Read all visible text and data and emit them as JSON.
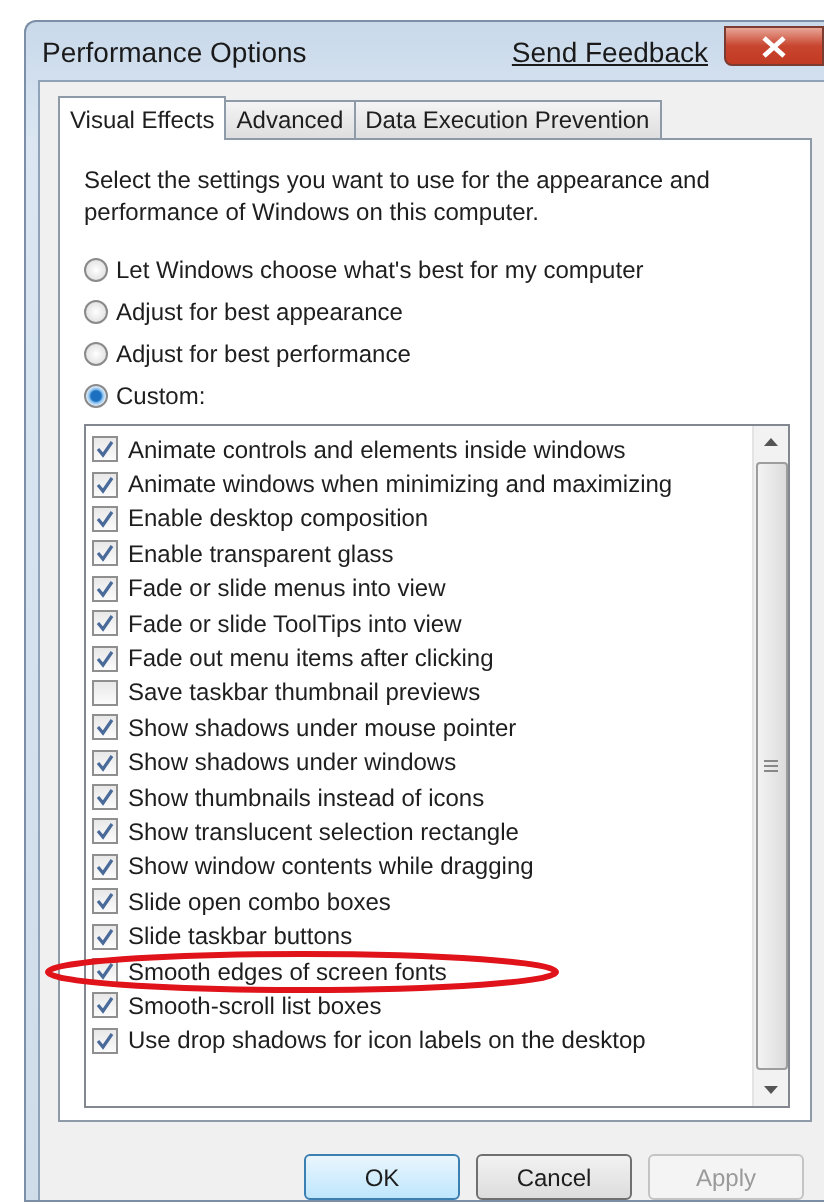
{
  "window": {
    "title": "Performance Options",
    "feedback_link": "Send Feedback"
  },
  "tabs": [
    {
      "label": "Visual Effects",
      "selected": true
    },
    {
      "label": "Advanced",
      "selected": false
    },
    {
      "label": "Data Execution Prevention",
      "selected": false
    }
  ],
  "description": "Select the settings you want to use for the appearance and performance of Windows on this computer.",
  "options": [
    {
      "label": "Let Windows choose what's best for my computer",
      "selected": false
    },
    {
      "label": "Adjust for best appearance",
      "selected": false
    },
    {
      "label": "Adjust for best performance",
      "selected": false
    },
    {
      "label": "Custom:",
      "selected": true
    }
  ],
  "effects": [
    {
      "label": "Animate controls and elements inside windows",
      "checked": true
    },
    {
      "label": "Animate windows when minimizing and maximizing",
      "checked": true
    },
    {
      "label": "Enable desktop composition",
      "checked": true
    },
    {
      "label": "Enable transparent glass",
      "checked": true
    },
    {
      "label": "Fade or slide menus into view",
      "checked": true
    },
    {
      "label": "Fade or slide ToolTips into view",
      "checked": true
    },
    {
      "label": "Fade out menu items after clicking",
      "checked": true
    },
    {
      "label": "Save taskbar thumbnail previews",
      "checked": false
    },
    {
      "label": "Show shadows under mouse pointer",
      "checked": true
    },
    {
      "label": "Show shadows under windows",
      "checked": true
    },
    {
      "label": "Show thumbnails instead of icons",
      "checked": true
    },
    {
      "label": "Show translucent selection rectangle",
      "checked": true
    },
    {
      "label": "Show window contents while dragging",
      "checked": true
    },
    {
      "label": "Slide open combo boxes",
      "checked": true
    },
    {
      "label": "Slide taskbar buttons",
      "checked": true
    },
    {
      "label": "Smooth edges of screen fonts",
      "checked": true
    },
    {
      "label": "Smooth-scroll list boxes",
      "checked": true
    },
    {
      "label": "Use drop shadows for icon labels on the desktop",
      "checked": true
    }
  ],
  "buttons": [
    {
      "label": "OK",
      "kind": "default",
      "disabled": false
    },
    {
      "label": "Cancel",
      "kind": "normal",
      "disabled": false
    },
    {
      "label": "Apply",
      "kind": "normal",
      "disabled": true
    }
  ]
}
